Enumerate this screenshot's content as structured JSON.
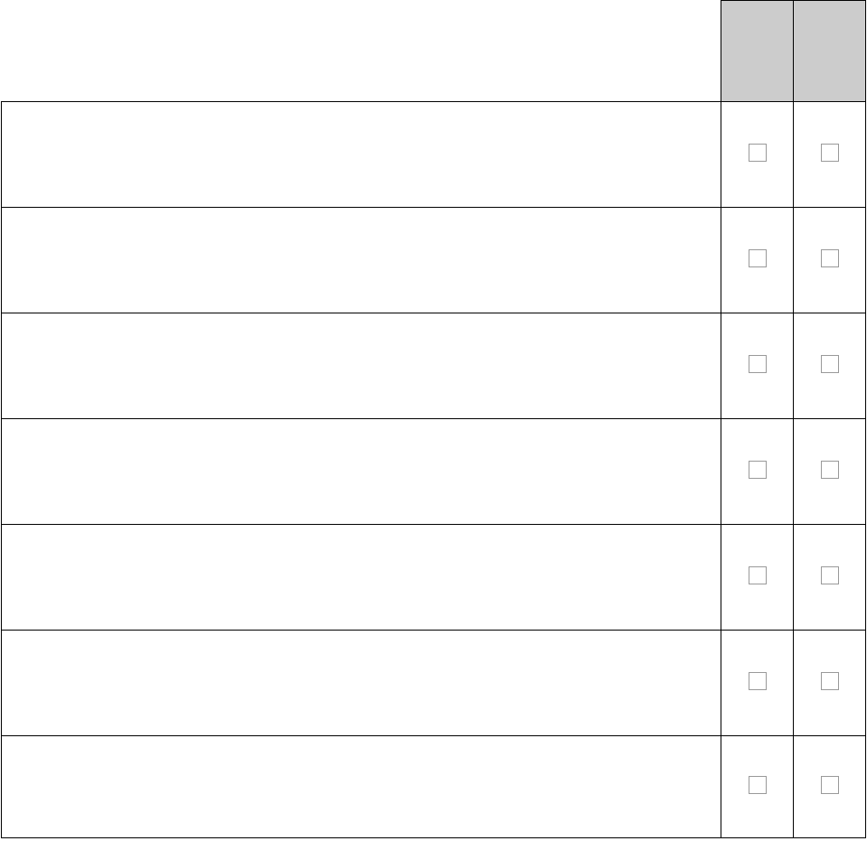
{
  "columns": [
    "",
    ""
  ],
  "rows": [
    {
      "label": ""
    },
    {
      "label": ""
    },
    {
      "label": ""
    },
    {
      "label": ""
    },
    {
      "label": ""
    },
    {
      "label": ""
    },
    {
      "label": ""
    }
  ]
}
